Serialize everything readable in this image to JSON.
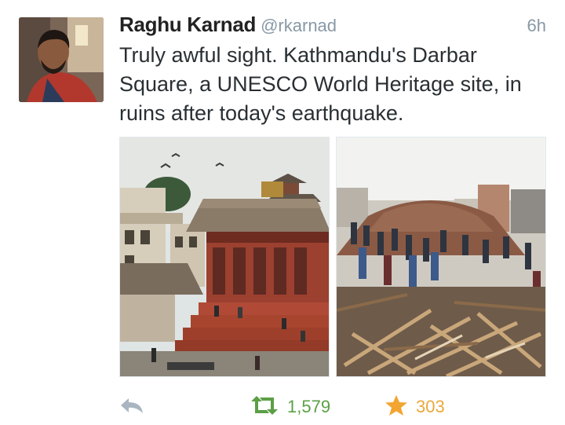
{
  "tweet": {
    "author_name": "Raghu Karnad",
    "author_handle": "@rkarnad",
    "timestamp": "6h",
    "text": "Truly awful sight. Kathmandu's Darbar Square, a UNESCO World Heritage site, in ruins after today's earthquake."
  },
  "media": [
    {
      "kind": "photo",
      "subject": "temple-before"
    },
    {
      "kind": "photo",
      "subject": "temple-ruins"
    }
  ],
  "actions": {
    "retweet_count": "1,579",
    "favorite_count": "303"
  },
  "colors": {
    "retweet_green": "#5c9f46",
    "favorite_gold": "#e9a93b",
    "muted_gray": "#8899a6",
    "name_text": "#222222"
  },
  "icons": [
    "reply-icon",
    "retweet-icon",
    "star-icon"
  ]
}
